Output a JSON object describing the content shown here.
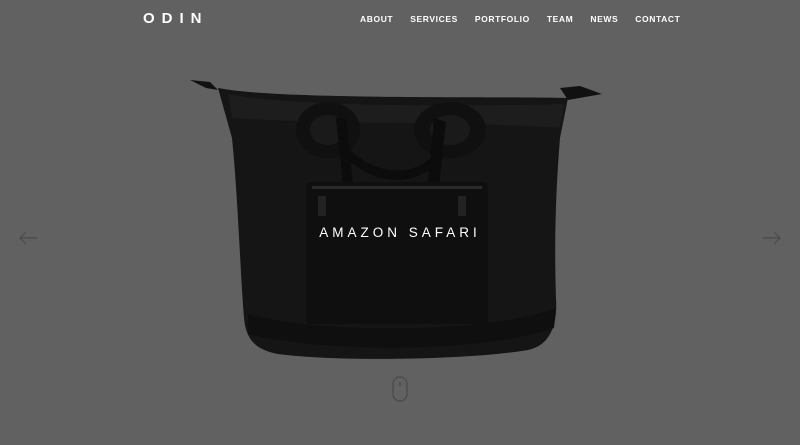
{
  "brand": {
    "logo": "ODIN"
  },
  "nav": {
    "items": [
      "ABOUT",
      "SERVICES",
      "PORTFOLIO",
      "TEAM",
      "NEWS",
      "CONTACT"
    ]
  },
  "hero": {
    "slide_title": "AMAZON SAFARI",
    "image": "black-duffel-bag-photo"
  },
  "controls": {
    "prev_icon": "arrow-left-icon",
    "next_icon": "arrow-right-icon",
    "scroll_icon": "mouse-scroll-icon"
  },
  "colors": {
    "background": "#616161",
    "text": "#ffffff",
    "bag": "#141414"
  }
}
